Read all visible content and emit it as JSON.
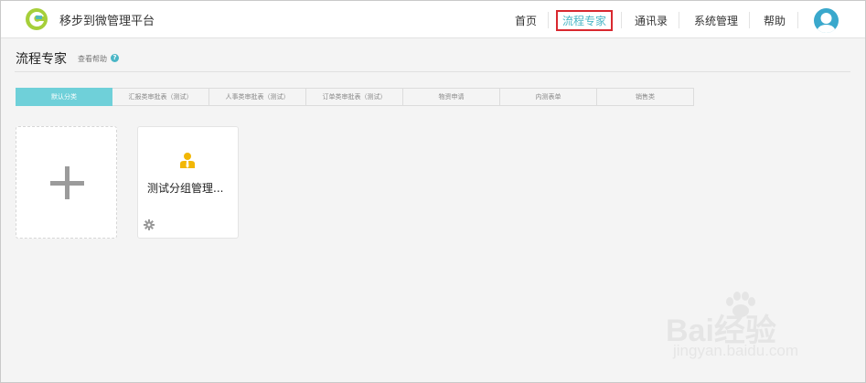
{
  "app": {
    "title": "移步到微管理平台"
  },
  "nav": {
    "items": [
      {
        "label": "首页",
        "active": false
      },
      {
        "label": "流程专家",
        "active": true
      },
      {
        "label": "通讯录",
        "active": false
      },
      {
        "label": "系统管理",
        "active": false
      },
      {
        "label": "帮助",
        "active": false
      }
    ]
  },
  "page": {
    "title": "流程专家",
    "help_link": "查看帮助",
    "help_icon": "?"
  },
  "tabs": [
    {
      "label": "默认分类",
      "active": true
    },
    {
      "label": "汇报类审批表（测试）",
      "active": false
    },
    {
      "label": "人事类审批表（测试）",
      "active": false
    },
    {
      "label": "订单类审批表（测试）",
      "active": false
    },
    {
      "label": "物资申请",
      "active": false
    },
    {
      "label": "内测表单",
      "active": false
    },
    {
      "label": "销售类",
      "active": false
    }
  ],
  "cards": {
    "flows": [
      {
        "name": "测试分组管理..."
      }
    ]
  },
  "watermark": {
    "text": "Bai经验",
    "url": "jingyan.baidu.com"
  },
  "colors": {
    "accent": "#4ab6c6",
    "tab_active": "#6fd0d9",
    "highlight_box": "#d9282f",
    "avatar": "#3aa8cc",
    "person_icon": "#f2b705"
  }
}
